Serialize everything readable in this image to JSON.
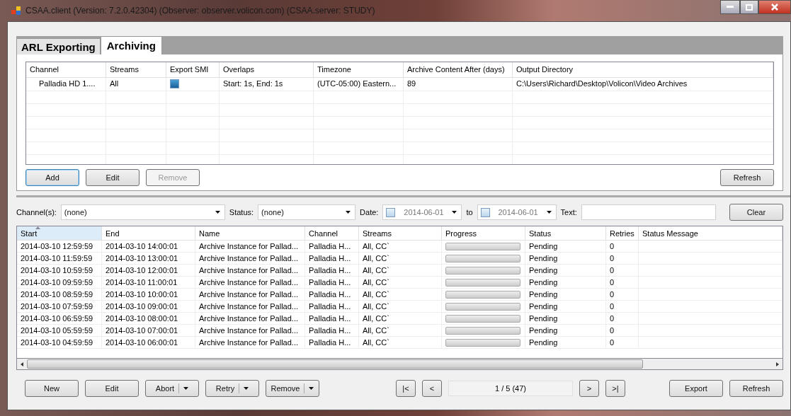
{
  "window": {
    "title": "CSAA.client (Version: 7.2.0.42304) (Observer: observer.volicon.com) (CSAA.server: STUDY)"
  },
  "tabs": [
    {
      "label": "ARL Exporting",
      "selected": false
    },
    {
      "label": "Archiving",
      "selected": true
    }
  ],
  "archive_table": {
    "columns": [
      {
        "label": "Channel"
      },
      {
        "label": "Streams"
      },
      {
        "label": "Export SMI"
      },
      {
        "label": "Overlaps"
      },
      {
        "label": "Timezone"
      },
      {
        "label": "Archive Content After (days)"
      },
      {
        "label": "Output Directory"
      }
    ],
    "rows": [
      {
        "channel": "Palladia HD 1....",
        "streams": "All",
        "export_smi": true,
        "overlaps": "Start: 1s, End: 1s",
        "timezone": "(UTC-05:00) Eastern...",
        "days": "89",
        "output": "C:\\Users\\Richard\\Desktop\\Volicon\\Video Archives"
      }
    ]
  },
  "archive_buttons": [
    {
      "label": "Add",
      "disabled": false,
      "focused": true
    },
    {
      "label": "Edit",
      "disabled": false,
      "focused": false
    },
    {
      "label": "Remove",
      "disabled": true,
      "focused": false
    }
  ],
  "archive_refresh": "Refresh",
  "filters": {
    "channels_label": "Channel(s):",
    "channels_value": "(none)",
    "status_label": "Status:",
    "status_value": "(none)",
    "date_label": "Date:",
    "date_from": {
      "value": "2014-06-01",
      "checked": false
    },
    "to_label": "to",
    "date_to": {
      "value": "2014-06-01",
      "checked": false
    },
    "text_label": "Text:",
    "clear": "Clear"
  },
  "instances_table": {
    "columns": [
      {
        "label": "Start",
        "sorted": true
      },
      {
        "label": "End",
        "sorted": false
      },
      {
        "label": "Name",
        "sorted": false
      },
      {
        "label": "Channel",
        "sorted": false
      },
      {
        "label": "Streams",
        "sorted": false
      },
      {
        "label": "Progress",
        "sorted": false
      },
      {
        "label": "Status",
        "sorted": false
      },
      {
        "label": "Retries",
        "sorted": false
      },
      {
        "label": "Status Message",
        "sorted": false
      }
    ],
    "rows": [
      {
        "start": "2014-03-10 12:59:59",
        "end": "2014-03-10 14:00:01",
        "name": "Archive Instance for Pallad...",
        "channel": "Palladia H...",
        "streams": "All, CC`",
        "level": 0,
        "status": "Pending",
        "retries": "0"
      },
      {
        "start": "2014-03-10 11:59:59",
        "end": "2014-03-10 13:00:01",
        "name": "Archive Instance for Pallad...",
        "channel": "Palladia H...",
        "streams": "All, CC`",
        "level": 0,
        "status": "Pending",
        "retries": "0"
      },
      {
        "start": "2014-03-10 10:59:59",
        "end": "2014-03-10 12:00:01",
        "name": "Archive Instance for Pallad...",
        "channel": "Palladia H...",
        "streams": "All, CC`",
        "level": 0,
        "status": "Pending",
        "retries": "0"
      },
      {
        "start": "2014-03-10 09:59:59",
        "end": "2014-03-10 11:00:01",
        "name": "Archive Instance for Pallad...",
        "channel": "Palladia H...",
        "streams": "All, CC`",
        "level": 0,
        "status": "Pending",
        "retries": "0"
      },
      {
        "start": "2014-03-10 08:59:59",
        "end": "2014-03-10 10:00:01",
        "name": "Archive Instance for Pallad...",
        "channel": "Palladia H...",
        "streams": "All, CC`",
        "level": 0,
        "status": "Pending",
        "retries": "0"
      },
      {
        "start": "2014-03-10 07:59:59",
        "end": "2014-03-10 09:00:01",
        "name": "Archive Instance for Pallad...",
        "channel": "Palladia H...",
        "streams": "All, CC`",
        "level": 0,
        "status": "Pending",
        "retries": "0"
      },
      {
        "start": "2014-03-10 06:59:59",
        "end": "2014-03-10 08:00:01",
        "name": "Archive Instance for Pallad...",
        "channel": "Palladia H...",
        "streams": "All, CC`",
        "level": 0,
        "status": "Pending",
        "retries": "0"
      },
      {
        "start": "2014-03-10 05:59:59",
        "end": "2014-03-10 07:00:01",
        "name": "Archive Instance for Pallad...",
        "channel": "Palladia H...",
        "streams": "All, CC`",
        "level": 0,
        "status": "Pending",
        "retries": "0"
      },
      {
        "start": "2014-03-10 04:59:59",
        "end": "2014-03-10 06:00:01",
        "name": "Archive Instance for Pallad...",
        "channel": "Palladia H...",
        "streams": "All, CC`",
        "level": 0,
        "status": "Pending",
        "retries": "0"
      }
    ]
  },
  "bottom_buttons": [
    {
      "label": "New",
      "kind": "plain"
    },
    {
      "label": "Edit",
      "kind": "plain"
    },
    {
      "label": "Abort",
      "kind": "split"
    },
    {
      "label": "Retry",
      "kind": "split"
    },
    {
      "label": "Remove",
      "kind": "split"
    }
  ],
  "pager": {
    "first": "|<",
    "prev": "<",
    "page": "1 / 5 (47)",
    "next": ">",
    "last": ">|"
  },
  "export": "Export",
  "refresh": "Refresh"
}
